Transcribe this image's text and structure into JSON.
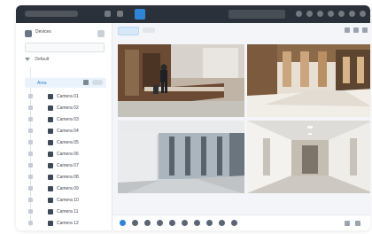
{
  "window": {
    "active_tab_index": 1
  },
  "sidebar": {
    "header_title": "Devices",
    "search_placeholder": "",
    "group_label": "Default",
    "selected_label": "Area",
    "camera_items": [
      {
        "label": "Camera 01"
      },
      {
        "label": "Camera 02"
      },
      {
        "label": "Camera 03"
      },
      {
        "label": "Camera 04"
      },
      {
        "label": "Camera 05"
      },
      {
        "label": "Camera 06"
      },
      {
        "label": "Camera 07"
      },
      {
        "label": "Camera 08"
      },
      {
        "label": "Camera 09"
      },
      {
        "label": "Camera 10"
      },
      {
        "label": "Camera 11"
      },
      {
        "label": "Camera 12"
      }
    ]
  },
  "main": {
    "tab_active_label": "",
    "tab_plain_label": ""
  },
  "colors": {
    "accent": "#2f84d8",
    "topbar": "#2b313a",
    "sidebar_bg": "#ffffff",
    "main_bg": "#f3f5f8"
  },
  "icons": {
    "topbar": [
      "app-icon",
      "window-icon",
      "live-view-icon",
      "search-icon",
      "settings-icon",
      "user-icon",
      "minimize-icon",
      "maximize-icon",
      "close-icon"
    ],
    "bottombar": [
      "play-icon",
      "pause-icon",
      "stop-icon",
      "record-icon",
      "snapshot-icon",
      "audio-icon",
      "zoom-icon",
      "fullscreen-icon",
      "layout-icon",
      "more-icon"
    ]
  },
  "video_tiles": [
    {
      "scene": "hotel-lobby-reception"
    },
    {
      "scene": "hotel-lobby-wide"
    },
    {
      "scene": "glass-corridor"
    },
    {
      "scene": "hallway"
    }
  ]
}
